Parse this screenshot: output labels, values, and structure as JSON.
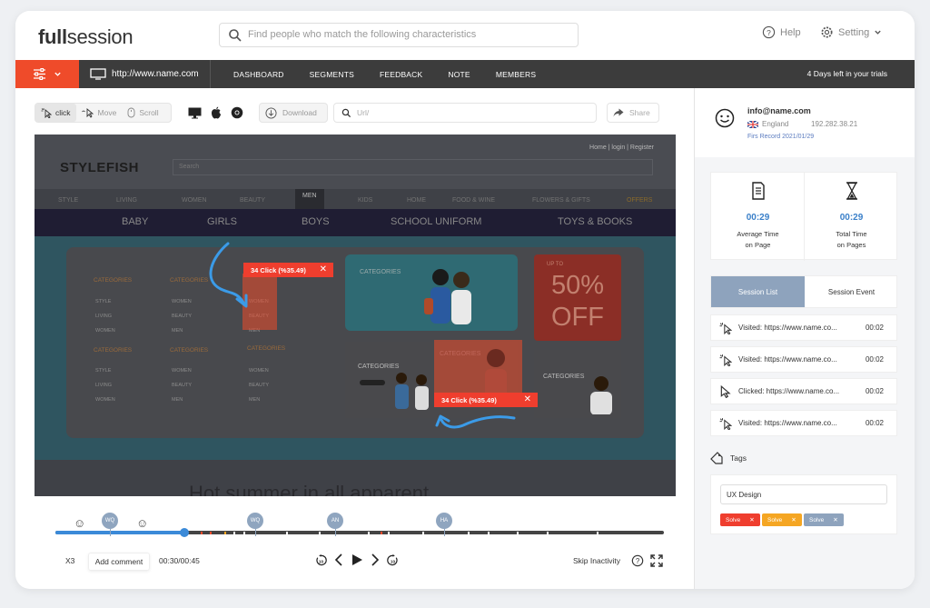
{
  "header": {
    "logo_bold": "full",
    "logo_rest": "session",
    "search_placeholder": "Find people who match the following characteristics",
    "help_label": "Help",
    "setting_label": "Setting"
  },
  "nav": {
    "url": "http://www.name.com",
    "items": [
      "DASHBOARD",
      "SEGMENTS",
      "FEEDBACK",
      "NOTE",
      "MEMBERS"
    ],
    "trial": "4 Days left in your trials"
  },
  "toolbar": {
    "click": "click",
    "move": "Move",
    "scroll": "Scroll",
    "download": "Download",
    "url_placeholder": "Url/",
    "share": "Share"
  },
  "recording": {
    "top_links": "Home   |   login   |   Register",
    "brand": "STYLEFISH",
    "search": "Search",
    "categories": [
      "STYLE",
      "LIVING",
      "WOMEN",
      "BEAUTY",
      "MEN",
      "KIDS",
      "HOME",
      "FOOD & WINE",
      "FLOWERS & GIFTS",
      "OFFERS"
    ],
    "subnav": [
      "BABY",
      "GIRLS",
      "BOYS",
      "SCHOOL UNIFORM",
      "TOYS & BOOKS"
    ],
    "col_heading": "CATEGORIES",
    "col1_items": [
      "STYLE",
      "LIVING",
      "WOMEN"
    ],
    "col2_items": [
      "WOMEN",
      "BEAUTY",
      "MEN"
    ],
    "banner_cat": "CATEGORIES",
    "sale_top": "UP TO",
    "sale_pct": "50%",
    "sale_off": "OFF",
    "bottom_text": "Hot summer in all apparent",
    "tip1": "34 Click (%35.49)",
    "tip2": "34 Click (%35.49)"
  },
  "timeline": {
    "progress": 0.21,
    "markers": [
      "WQ",
      "WQ",
      "AN",
      "HA"
    ],
    "speed": "X3",
    "add_comment": "Add comment",
    "time": "00:30/00:45",
    "skip": "Skip Inactivity"
  },
  "panel": {
    "email": "info@name.com",
    "country": "England",
    "ip": "192.282.38.21",
    "first_record": "Firs Record 2021/01/29",
    "avg_time": "00:29",
    "avg_label_1": "Average Time",
    "avg_label_2": "on Page",
    "total_time": "00:29",
    "total_label_1": "Total Time",
    "total_label_2": "on Pages",
    "tab_list": "Session List",
    "tab_event": "Session Event",
    "events": [
      {
        "text": "Visited: https://www.name.co...",
        "time": "00:02",
        "icon": "click-icon"
      },
      {
        "text": "Visited: https://www.name.co...",
        "time": "00:02",
        "icon": "click-icon"
      },
      {
        "text": "Clicked: https://www.name.co...",
        "time": "00:02",
        "icon": "cursor-icon"
      },
      {
        "text": "Visited: https://www.name.co...",
        "time": "00:02",
        "icon": "click-icon"
      }
    ],
    "tags_label": "Tags",
    "tag_input": "UX Design",
    "chips": [
      {
        "label": "Solve",
        "color": "#ef3e2e"
      },
      {
        "label": "Solve",
        "color": "#f5a623"
      },
      {
        "label": "Solve",
        "color": "#8ea3bd"
      }
    ]
  }
}
